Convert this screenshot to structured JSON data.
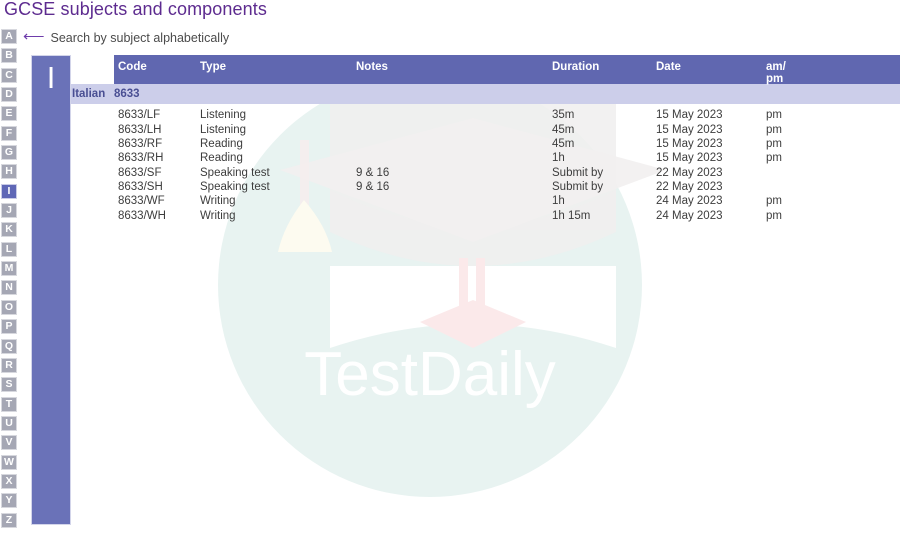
{
  "page": {
    "title": "GCSE subjects and components"
  },
  "search": {
    "arrow_icon": "left-arrow-icon",
    "hint": "Search by subject alphabetically"
  },
  "alphabet": {
    "letters": [
      "A",
      "B",
      "C",
      "D",
      "E",
      "F",
      "G",
      "H",
      "I",
      "J",
      "K",
      "L",
      "M",
      "N",
      "O",
      "P",
      "Q",
      "R",
      "S",
      "T",
      "U",
      "V",
      "W",
      "X",
      "Y",
      "Z"
    ],
    "active": "I"
  },
  "letter_panel": {
    "letter": "I"
  },
  "colors": {
    "title_purple": "#5d2b8f",
    "header_blue": "#6067b0",
    "subject_row": "#ccceea",
    "panel_blue": "#6a72b8",
    "letter_inactive": "#a5a7b4",
    "watermark_teal": "#e6f2f0"
  },
  "table": {
    "columns": [
      {
        "key": "subject",
        "label": ""
      },
      {
        "key": "code",
        "label": "Code"
      },
      {
        "key": "type",
        "label": "Type"
      },
      {
        "key": "notes",
        "label": "Notes"
      },
      {
        "key": "duration",
        "label": "Duration"
      },
      {
        "key": "date",
        "label": "Date"
      },
      {
        "key": "ampm",
        "label": "am/\npm"
      }
    ],
    "subject": {
      "name": "Italian",
      "code": "8633"
    },
    "rows": [
      {
        "code": "8633/LF",
        "type": "Listening",
        "notes": "",
        "duration": "35m",
        "date": "15 May 2023",
        "ampm": "pm"
      },
      {
        "code": "8633/LH",
        "type": "Listening",
        "notes": "",
        "duration": "45m",
        "date": "15 May 2023",
        "ampm": "pm"
      },
      {
        "code": "8633/RF",
        "type": "Reading",
        "notes": "",
        "duration": "45m",
        "date": "15 May 2023",
        "ampm": "pm"
      },
      {
        "code": "8633/RH",
        "type": "Reading",
        "notes": "",
        "duration": "1h",
        "date": "15 May 2023",
        "ampm": "pm"
      },
      {
        "code": "8633/SF",
        "type": "Speaking test",
        "notes": "9 & 16",
        "duration": "Submit by",
        "date": "22 May 2023",
        "ampm": ""
      },
      {
        "code": "8633/SH",
        "type": "Speaking test",
        "notes": "9 & 16",
        "duration": "Submit by",
        "date": "22 May 2023",
        "ampm": ""
      },
      {
        "code": "8633/WF",
        "type": "Writing",
        "notes": "",
        "duration": "1h",
        "date": "24 May 2023",
        "ampm": "pm"
      },
      {
        "code": "8633/WH",
        "type": "Writing",
        "notes": "",
        "duration": "1h 15m",
        "date": "24 May 2023",
        "ampm": "pm"
      }
    ]
  },
  "watermark": {
    "text": "TestDaily",
    "graphic": "graduation-cap-icon"
  }
}
